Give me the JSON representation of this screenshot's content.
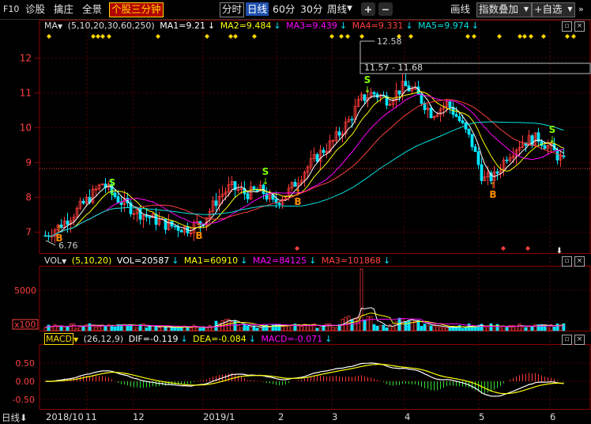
{
  "toolbar": {
    "f10": "F10",
    "diagnose": "诊股",
    "select": "擒庄",
    "panorama": "全景",
    "intraday_3min": "个股三分钟",
    "periods": [
      "分时",
      "日线",
      "60分",
      "30分",
      "周线"
    ],
    "period_dropdown_icon": "chevron-down-icon",
    "zoom_in": "+",
    "zoom_out": "−",
    "draw_line": "画线",
    "overlay_index": "指数叠加",
    "add_watchlist": "+自选"
  },
  "ma_header": {
    "label": "MA",
    "params": "(5,10,20,30,60,250)",
    "ma1": "MA1=9.21",
    "ma2": "MA2=9.484",
    "ma3": "MA3=9.439",
    "ma4": "MA4=9.331",
    "ma5": "MA5=9.974"
  },
  "vol_header": {
    "label": "VOL",
    "params": "(5,10,20)",
    "vol": "VOL=20587",
    "ma1": "MA1=60910",
    "ma2": "MA2=84125",
    "ma3": "MA3=101868"
  },
  "macd_header": {
    "label": "MACD",
    "params": "(26,12,9)",
    "dif": "DIF=-0.119",
    "dea": "DEA=-0.084",
    "macd": "MACD=-0.071"
  },
  "price_axis": [
    "12",
    "11",
    "10",
    "9",
    "8",
    "7"
  ],
  "vol_axis": [
    "5000",
    "x100"
  ],
  "macd_axis": [
    "0.50",
    "0.00",
    "-0.50"
  ],
  "annotations": {
    "high_price": "12.58",
    "low_price": "6.76",
    "range_label": "11.57 - 11.68",
    "signal_b": "B",
    "signal_s": "S"
  },
  "date_axis": {
    "period_label": "日线",
    "labels": [
      "2018/10",
      "11",
      "12",
      "2019/1",
      "2",
      "3",
      "4",
      "5",
      "6"
    ]
  },
  "colors": {
    "up": "#ff3b3b",
    "down": "#00e5ff",
    "ma1": "#ffffff",
    "ma2": "#ffff00",
    "ma3": "#ff00ff",
    "ma4": "#ff4040",
    "ma5": "#00e0e0",
    "vol_ma1": "#ffffff",
    "vol_ma2": "#ffff00",
    "vol_ma3": "#ff00ff"
  }
}
